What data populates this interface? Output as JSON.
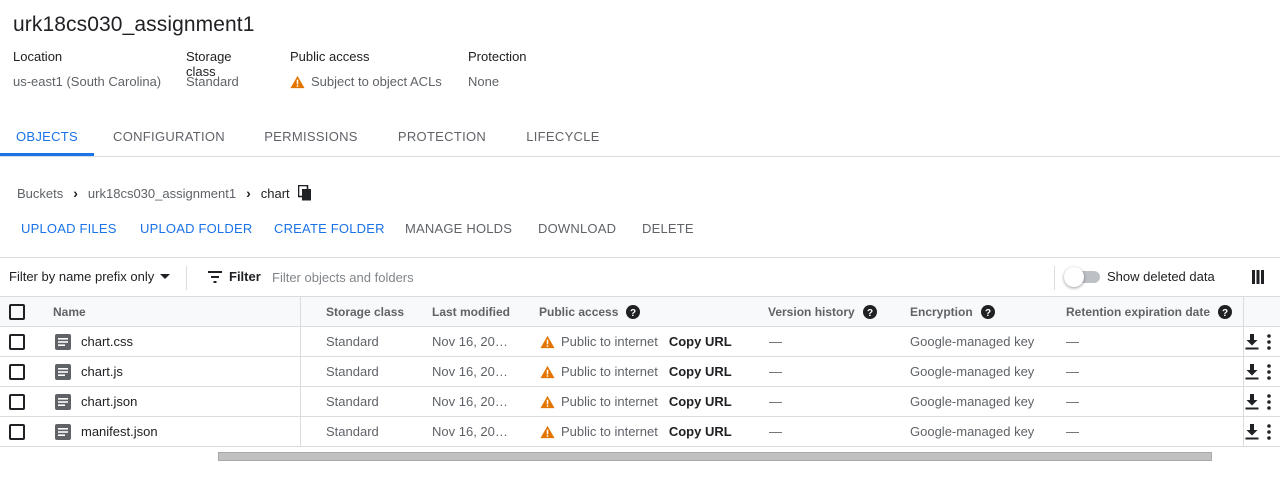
{
  "bucket": {
    "name": "urk18cs030_assignment1"
  },
  "meta": {
    "location_label": "Location",
    "location_value": "us-east1 (South Carolina)",
    "storage_label": "Storage class",
    "storage_value": "Standard",
    "public_label": "Public access",
    "public_value": "Subject to object ACLs",
    "protection_label": "Protection",
    "protection_value": "None"
  },
  "tabs": [
    {
      "label": "OBJECTS",
      "active": true
    },
    {
      "label": "CONFIGURATION",
      "active": false
    },
    {
      "label": "PERMISSIONS",
      "active": false
    },
    {
      "label": "PROTECTION",
      "active": false
    },
    {
      "label": "LIFECYCLE",
      "active": false
    }
  ],
  "breadcrumb": {
    "root": "Buckets",
    "bucket": "urk18cs030_assignment1",
    "folder": "chart"
  },
  "actions": {
    "upload_files": "UPLOAD FILES",
    "upload_folder": "UPLOAD FOLDER",
    "create_folder": "CREATE FOLDER",
    "manage_holds": "MANAGE HOLDS",
    "download": "DOWNLOAD",
    "delete": "DELETE"
  },
  "filter": {
    "mode": "Filter by name prefix only",
    "label": "Filter",
    "placeholder": "Filter objects and folders",
    "show_deleted_label": "Show deleted data",
    "show_deleted": false
  },
  "table": {
    "headers": {
      "name": "Name",
      "storage_class": "Storage class",
      "last_modified": "Last modified",
      "public_access": "Public access",
      "version_history": "Version history",
      "encryption": "Encryption",
      "retention": "Retention expiration date"
    },
    "rows": [
      {
        "name": "chart.css",
        "storage_class": "Standard",
        "last_modified": "Nov 16, 20…",
        "public_access": "Public to internet",
        "copy_url": "Copy URL",
        "version_history": "—",
        "encryption": "Google-managed key",
        "retention": "—"
      },
      {
        "name": "chart.js",
        "storage_class": "Standard",
        "last_modified": "Nov 16, 20…",
        "public_access": "Public to internet",
        "copy_url": "Copy URL",
        "version_history": "—",
        "encryption": "Google-managed key",
        "retention": "—"
      },
      {
        "name": "chart.json",
        "storage_class": "Standard",
        "last_modified": "Nov 16, 20…",
        "public_access": "Public to internet",
        "copy_url": "Copy URL",
        "version_history": "—",
        "encryption": "Google-managed key",
        "retention": "—"
      },
      {
        "name": "manifest.json",
        "storage_class": "Standard",
        "last_modified": "Nov 16, 20…",
        "public_access": "Public to internet",
        "copy_url": "Copy URL",
        "version_history": "—",
        "encryption": "Google-managed key",
        "retention": "—"
      }
    ]
  },
  "colors": {
    "accent": "#1a73e8",
    "warning": "#e37400",
    "text": "#202124",
    "muted": "#5f6368",
    "divider": "#dadce0"
  },
  "icons": {
    "warning": "warning-triangle-icon",
    "copy": "copy-icon",
    "filter": "filter-lines-icon",
    "file": "file-icon",
    "download": "download-icon",
    "more": "more-vert-icon",
    "help": "help-icon",
    "columns": "column-display-icon"
  }
}
